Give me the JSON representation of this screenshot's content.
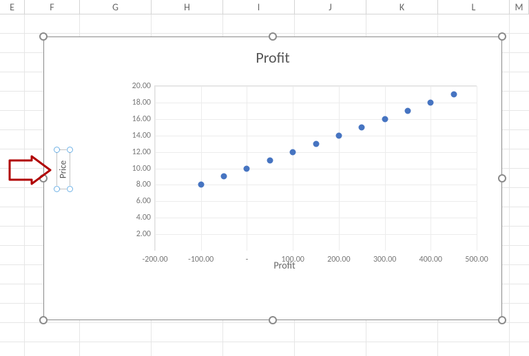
{
  "columns": [
    "E",
    "F",
    "G",
    "H",
    "I",
    "J",
    "K",
    "L",
    "M"
  ],
  "chart": {
    "title": "Profit",
    "x_axis_title": "Profit",
    "y_axis_title": "Price",
    "y_ticks": [
      "20.00",
      "18.00",
      "16.00",
      "14.00",
      "12.00",
      "10.00",
      "8.00",
      "6.00",
      "4.00",
      "2.00"
    ],
    "x_ticks": [
      "-200.00",
      "-100.00",
      "-",
      "100.00",
      "200.00",
      "300.00",
      "400.00",
      "500.00"
    ]
  },
  "chart_data": {
    "type": "scatter",
    "title": "Profit",
    "xlabel": "Profit",
    "ylabel": "Price",
    "xlim": [
      -200,
      500
    ],
    "ylim": [
      0,
      20
    ],
    "series": [
      {
        "name": "Profit",
        "color": "#4674c1",
        "points": [
          {
            "x": -100,
            "y": 8
          },
          {
            "x": -50,
            "y": 9
          },
          {
            "x": 0,
            "y": 10
          },
          {
            "x": 50,
            "y": 11
          },
          {
            "x": 100,
            "y": 12
          },
          {
            "x": 150,
            "y": 13
          },
          {
            "x": 200,
            "y": 14
          },
          {
            "x": 250,
            "y": 15
          },
          {
            "x": 300,
            "y": 16
          },
          {
            "x": 350,
            "y": 17
          },
          {
            "x": 400,
            "y": 18
          },
          {
            "x": 450,
            "y": 19
          }
        ]
      }
    ]
  }
}
